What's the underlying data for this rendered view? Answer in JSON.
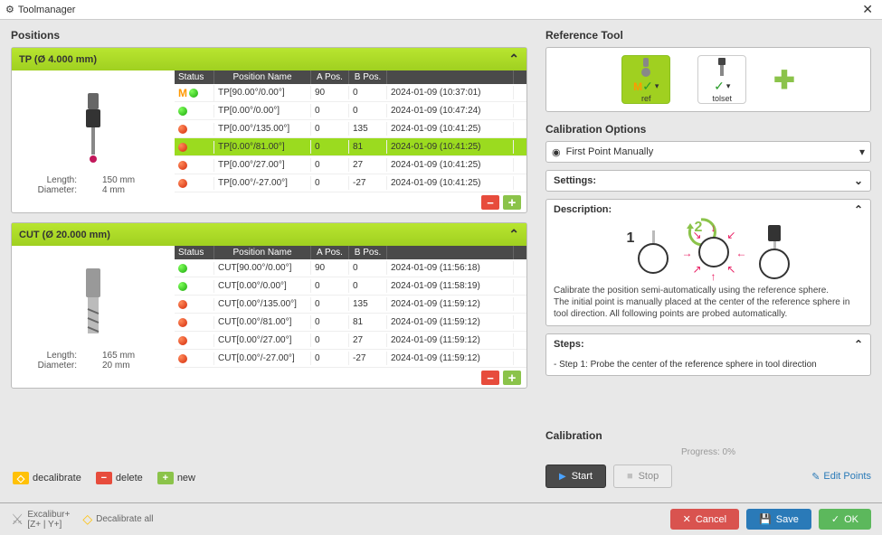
{
  "window": {
    "title": "Toolmanager"
  },
  "positions": {
    "title": "Positions",
    "headers": {
      "status": "Status",
      "name": "Position Name",
      "apos": "A Pos.",
      "bpos": "B Pos."
    },
    "groups": [
      {
        "header": "TP (Ø 4.000 mm)",
        "meta": {
          "length_label": "Length:",
          "length_val": "150 mm",
          "diam_label": "Diameter:",
          "diam_val": "4 mm"
        },
        "rows": [
          {
            "status": "m-green",
            "name": "TP[90.00°/0.00°]",
            "a": "90",
            "b": "0",
            "date": "2024-01-09 (10:37:01)",
            "sel": false
          },
          {
            "status": "green",
            "name": "TP[0.00°/0.00°]",
            "a": "0",
            "b": "0",
            "date": "2024-01-09 (10:47:24)",
            "sel": false
          },
          {
            "status": "red",
            "name": "TP[0.00°/135.00°]",
            "a": "0",
            "b": "135",
            "date": "2024-01-09 (10:41:25)",
            "sel": false
          },
          {
            "status": "red",
            "name": "TP[0.00°/81.00°]",
            "a": "0",
            "b": "81",
            "date": "2024-01-09 (10:41:25)",
            "sel": true
          },
          {
            "status": "red",
            "name": "TP[0.00°/27.00°]",
            "a": "0",
            "b": "27",
            "date": "2024-01-09 (10:41:25)",
            "sel": false
          },
          {
            "status": "red",
            "name": "TP[0.00°/-27.00°]",
            "a": "0",
            "b": "-27",
            "date": "2024-01-09 (10:41:25)",
            "sel": false
          }
        ]
      },
      {
        "header": "CUT (Ø 20.000 mm)",
        "meta": {
          "length_label": "Length:",
          "length_val": "165 mm",
          "diam_label": "Diameter:",
          "diam_val": "20 mm"
        },
        "rows": [
          {
            "status": "green",
            "name": "CUT[90.00°/0.00°]",
            "a": "90",
            "b": "0",
            "date": "2024-01-09 (11:56:18)",
            "sel": false
          },
          {
            "status": "green",
            "name": "CUT[0.00°/0.00°]",
            "a": "0",
            "b": "0",
            "date": "2024-01-09 (11:58:19)",
            "sel": false
          },
          {
            "status": "red",
            "name": "CUT[0.00°/135.00°]",
            "a": "0",
            "b": "135",
            "date": "2024-01-09 (11:59:12)",
            "sel": false
          },
          {
            "status": "red",
            "name": "CUT[0.00°/81.00°]",
            "a": "0",
            "b": "81",
            "date": "2024-01-09 (11:59:12)",
            "sel": false
          },
          {
            "status": "red",
            "name": "CUT[0.00°/27.00°]",
            "a": "0",
            "b": "27",
            "date": "2024-01-09 (11:59:12)",
            "sel": false
          },
          {
            "status": "red",
            "name": "CUT[0.00°/-27.00°]",
            "a": "0",
            "b": "-27",
            "date": "2024-01-09 (11:59:12)",
            "sel": false
          }
        ]
      }
    ],
    "legend": {
      "decal": "decalibrate",
      "del": "delete",
      "new": "new"
    }
  },
  "reference": {
    "title": "Reference Tool",
    "ref_label": "ref",
    "tolset_label": "tolset"
  },
  "calib_opts": {
    "title": "Calibration Options",
    "selected": "First Point Manually"
  },
  "settings": {
    "title": "Settings:"
  },
  "description": {
    "title": "Description:",
    "num1": "1",
    "num2": "2",
    "text1": "Calibrate the position semi-automatically using the reference sphere.",
    "text2": "The initial point is manually placed at the center of the reference sphere in tool direction. All following points are probed automatically."
  },
  "steps": {
    "title": "Steps:",
    "s1": "- Step 1: Probe the center of the reference sphere in tool direction"
  },
  "calibration": {
    "title": "Calibration",
    "progress": "Progress: 0%",
    "start": "Start",
    "stop": "Stop",
    "edit": "Edit Points"
  },
  "footer": {
    "excalibur": "Excalibur+",
    "axes": "[Z+ | Y+]",
    "decal_all": "Decalibrate all",
    "cancel": "Cancel",
    "save": "Save",
    "ok": "OK"
  }
}
